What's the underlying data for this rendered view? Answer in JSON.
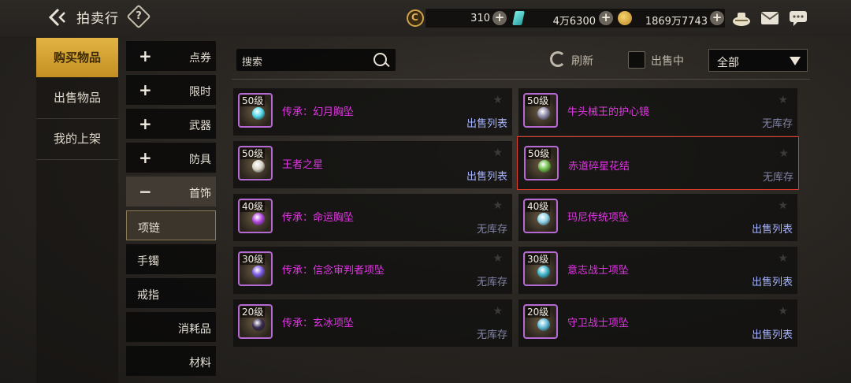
{
  "header": {
    "title": "拍卖行",
    "help_label": "?"
  },
  "currency": {
    "coin_amount": "310",
    "gem_amount": "4万6300",
    "gold_amount": "1869万7743",
    "plus_label": "+"
  },
  "categories": [
    {
      "label": "购买物品",
      "active": true
    },
    {
      "label": "出售物品",
      "active": false
    },
    {
      "label": "我的上架",
      "active": false
    }
  ],
  "subcategories": [
    {
      "sign": "+",
      "label": "点券"
    },
    {
      "sign": "+",
      "label": "限时"
    },
    {
      "sign": "+",
      "label": "武器"
    },
    {
      "sign": "+",
      "label": "防具"
    },
    {
      "sign": "−",
      "label": "首饰"
    }
  ],
  "leaf_categories": [
    {
      "label": "项链",
      "selected": true
    },
    {
      "label": "手镯",
      "selected": false
    },
    {
      "label": "戒指",
      "selected": false
    },
    {
      "label": "消耗品",
      "selected": false
    },
    {
      "label": "材料",
      "selected": false
    }
  ],
  "toolbar": {
    "search_placeholder": "搜索",
    "refresh_label": "刷新",
    "on_sale_label": "出售中",
    "filter_value": "全部"
  },
  "items": [
    {
      "level": "50级",
      "name": "传承：幻月胸坠",
      "status": "出售列表",
      "in_stock": true,
      "gem_color": "#4fd7e8"
    },
    {
      "level": "50级",
      "name": "牛头械王的护心镜",
      "status": "无库存",
      "in_stock": false,
      "gem_color": "#8f8aa8"
    },
    {
      "level": "50级",
      "name": "王者之星",
      "status": "出售列表",
      "in_stock": true,
      "gem_color": "#d9d4c6"
    },
    {
      "level": "50级",
      "name": "赤道碎星花结",
      "status": "无库存",
      "in_stock": false,
      "gem_color": "#6fbf4a"
    },
    {
      "level": "40级",
      "name": "传承：命运胸坠",
      "status": "无库存",
      "in_stock": false,
      "gem_color": "#b247e0"
    },
    {
      "level": "40级",
      "name": "玛尼传统项坠",
      "status": "出售列表",
      "in_stock": true,
      "gem_color": "#8fd3e8"
    },
    {
      "level": "30级",
      "name": "传承：信念审判者项坠",
      "status": "无库存",
      "in_stock": false,
      "gem_color": "#7a5ae0"
    },
    {
      "level": "30级",
      "name": "意志战士项坠",
      "status": "出售列表",
      "in_stock": true,
      "gem_color": "#3fb4c9"
    },
    {
      "level": "20级",
      "name": "传承：玄冰项坠",
      "status": "无库存",
      "in_stock": false,
      "gem_color": "#3a2c50"
    },
    {
      "level": "20级",
      "name": "守卫战士项坠",
      "status": "出售列表",
      "in_stock": true,
      "gem_color": "#5fbad6"
    }
  ],
  "colors": {
    "accent_gold": "#d4a232",
    "item_name_purple": "#e235e4",
    "status_listing": "#a7b4ff",
    "status_nostock": "#8385a6",
    "highlight_border": "#e13b2e"
  }
}
